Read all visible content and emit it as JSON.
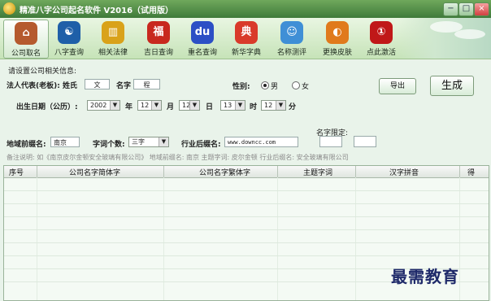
{
  "window": {
    "title": "精准八字公司起名软件 V2016（试用版）",
    "controls": [
      "−",
      "□",
      "×"
    ]
  },
  "toolbar": {
    "items": [
      {
        "label": "公司取名",
        "icon": "house-icon",
        "glyph": "⌂",
        "color": "#b55a2e"
      },
      {
        "label": "八字查询",
        "icon": "yin-yang-icon",
        "glyph": "☯",
        "color": "#1f5fa8"
      },
      {
        "label": "相关法律",
        "icon": "book-icon",
        "glyph": "▥",
        "color": "#d9a21a"
      },
      {
        "label": "吉日查询",
        "icon": "lantern-icon",
        "glyph": "福",
        "color": "#c8281e"
      },
      {
        "label": "重名查询",
        "icon": "baidu-paw-icon",
        "glyph": "du",
        "color": "#2c4fc5"
      },
      {
        "label": "新华字典",
        "icon": "dictionary-icon",
        "glyph": "典",
        "color": "#d93a2a"
      },
      {
        "label": "名称测评",
        "icon": "cartoon-face-icon",
        "glyph": "☺",
        "color": "#3f8fd6"
      },
      {
        "label": "更换皮肤",
        "icon": "palette-icon",
        "glyph": "◐",
        "color": "#e07a1c"
      },
      {
        "label": "点此激活",
        "icon": "activate-icon",
        "glyph": "①",
        "color": "#c01818"
      }
    ]
  },
  "form": {
    "section_title": "请设置公司相关信息:",
    "legal_rep_label": "法人代表(老板): 姓氏",
    "surname": "文",
    "name_label": "名字",
    "given_name": "程",
    "gender_label": "性别:",
    "gender_male": "男",
    "gender_female": "女",
    "export_button": "导出",
    "generate_button": "生成",
    "birth_label": "出生日期（公历）:",
    "year": "2002",
    "year_unit": "年",
    "month": "12",
    "month_unit": "月",
    "day": "12",
    "day_unit": "日",
    "hour": "13",
    "hour_unit": "时",
    "minute": "12",
    "minute_unit": "分",
    "region_label": "地域前缀名:",
    "region_value": "南京",
    "word_count_label": "字词个数:",
    "word_count_value": "三字",
    "industry_label": "行业后缀名:",
    "industry_value": "www.downcc.com",
    "name_limit_label": "名字限定:",
    "note": "备注说明:  如《南京皮尔金顿安全玻璃有限公司》   地域前缀名: 南京      主题字词: 皮尔金顿          行业后缀名:  安全玻璃有限公司"
  },
  "table": {
    "columns": [
      "序号",
      "公司名字简体字",
      "公司名字繁体字",
      "主题字词",
      "汉字拼音",
      "得"
    ]
  },
  "watermark": "最需教育"
}
